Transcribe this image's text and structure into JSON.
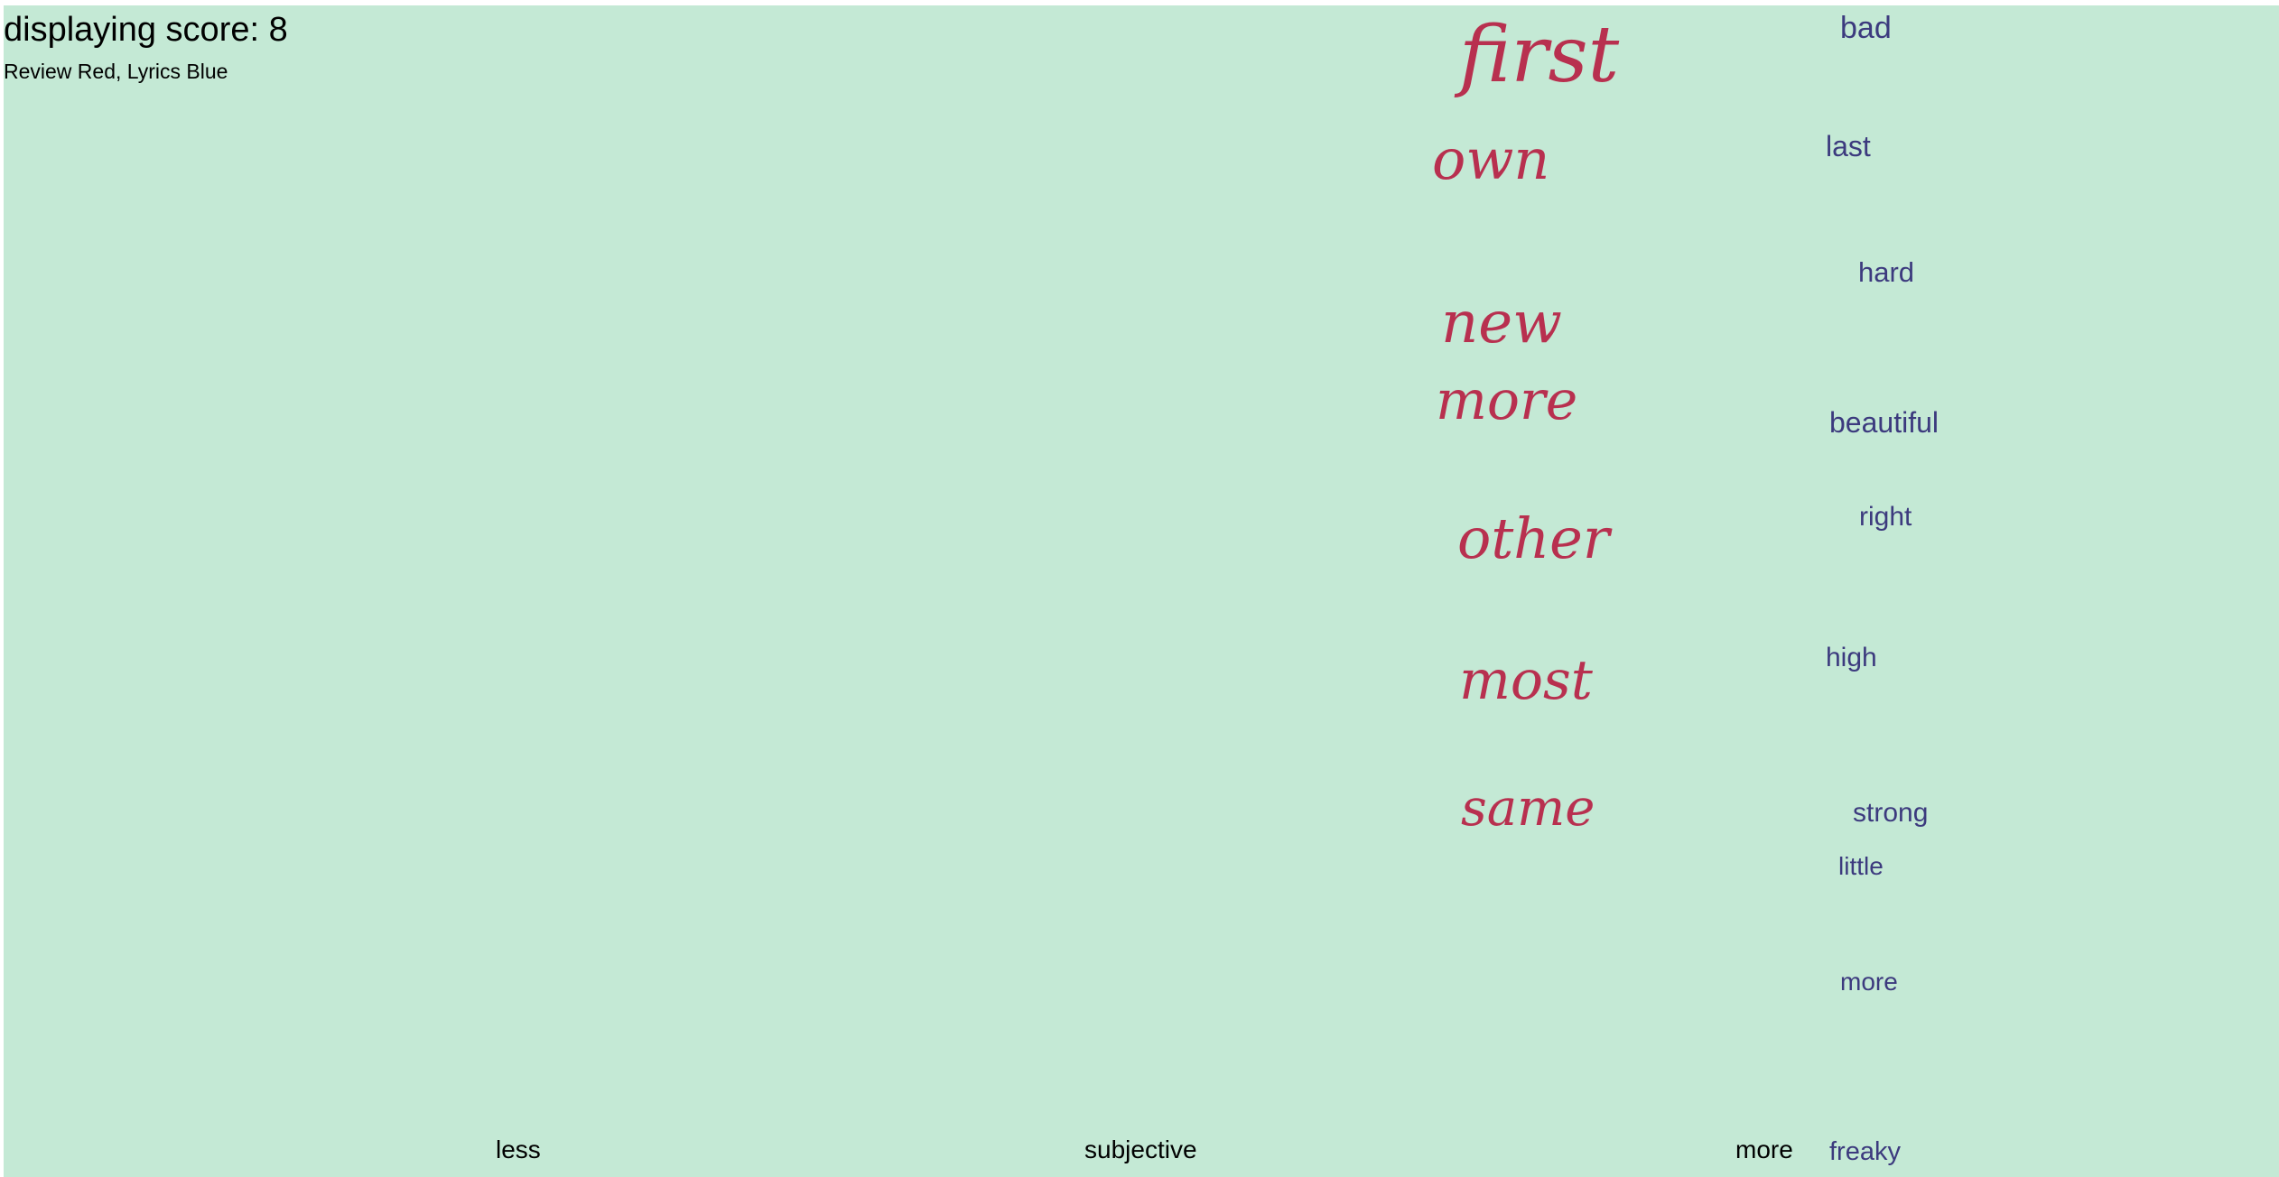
{
  "header": {
    "score_text": "displaying score: 8",
    "legend_text": "Review Red, Lyrics Blue"
  },
  "colors": {
    "background": "#c4e9d5",
    "review": "#b8304f",
    "lyrics": "#3c3a7e"
  },
  "review_words": [
    "first",
    "own",
    "new",
    "more",
    "other",
    "most",
    "same"
  ],
  "lyrics_words": [
    "bad",
    "last",
    "hard",
    "beautiful",
    "right",
    "high",
    "strong",
    "little",
    "more",
    "freaky"
  ],
  "axis": {
    "left": "less",
    "center": "subjective",
    "right": "more"
  }
}
